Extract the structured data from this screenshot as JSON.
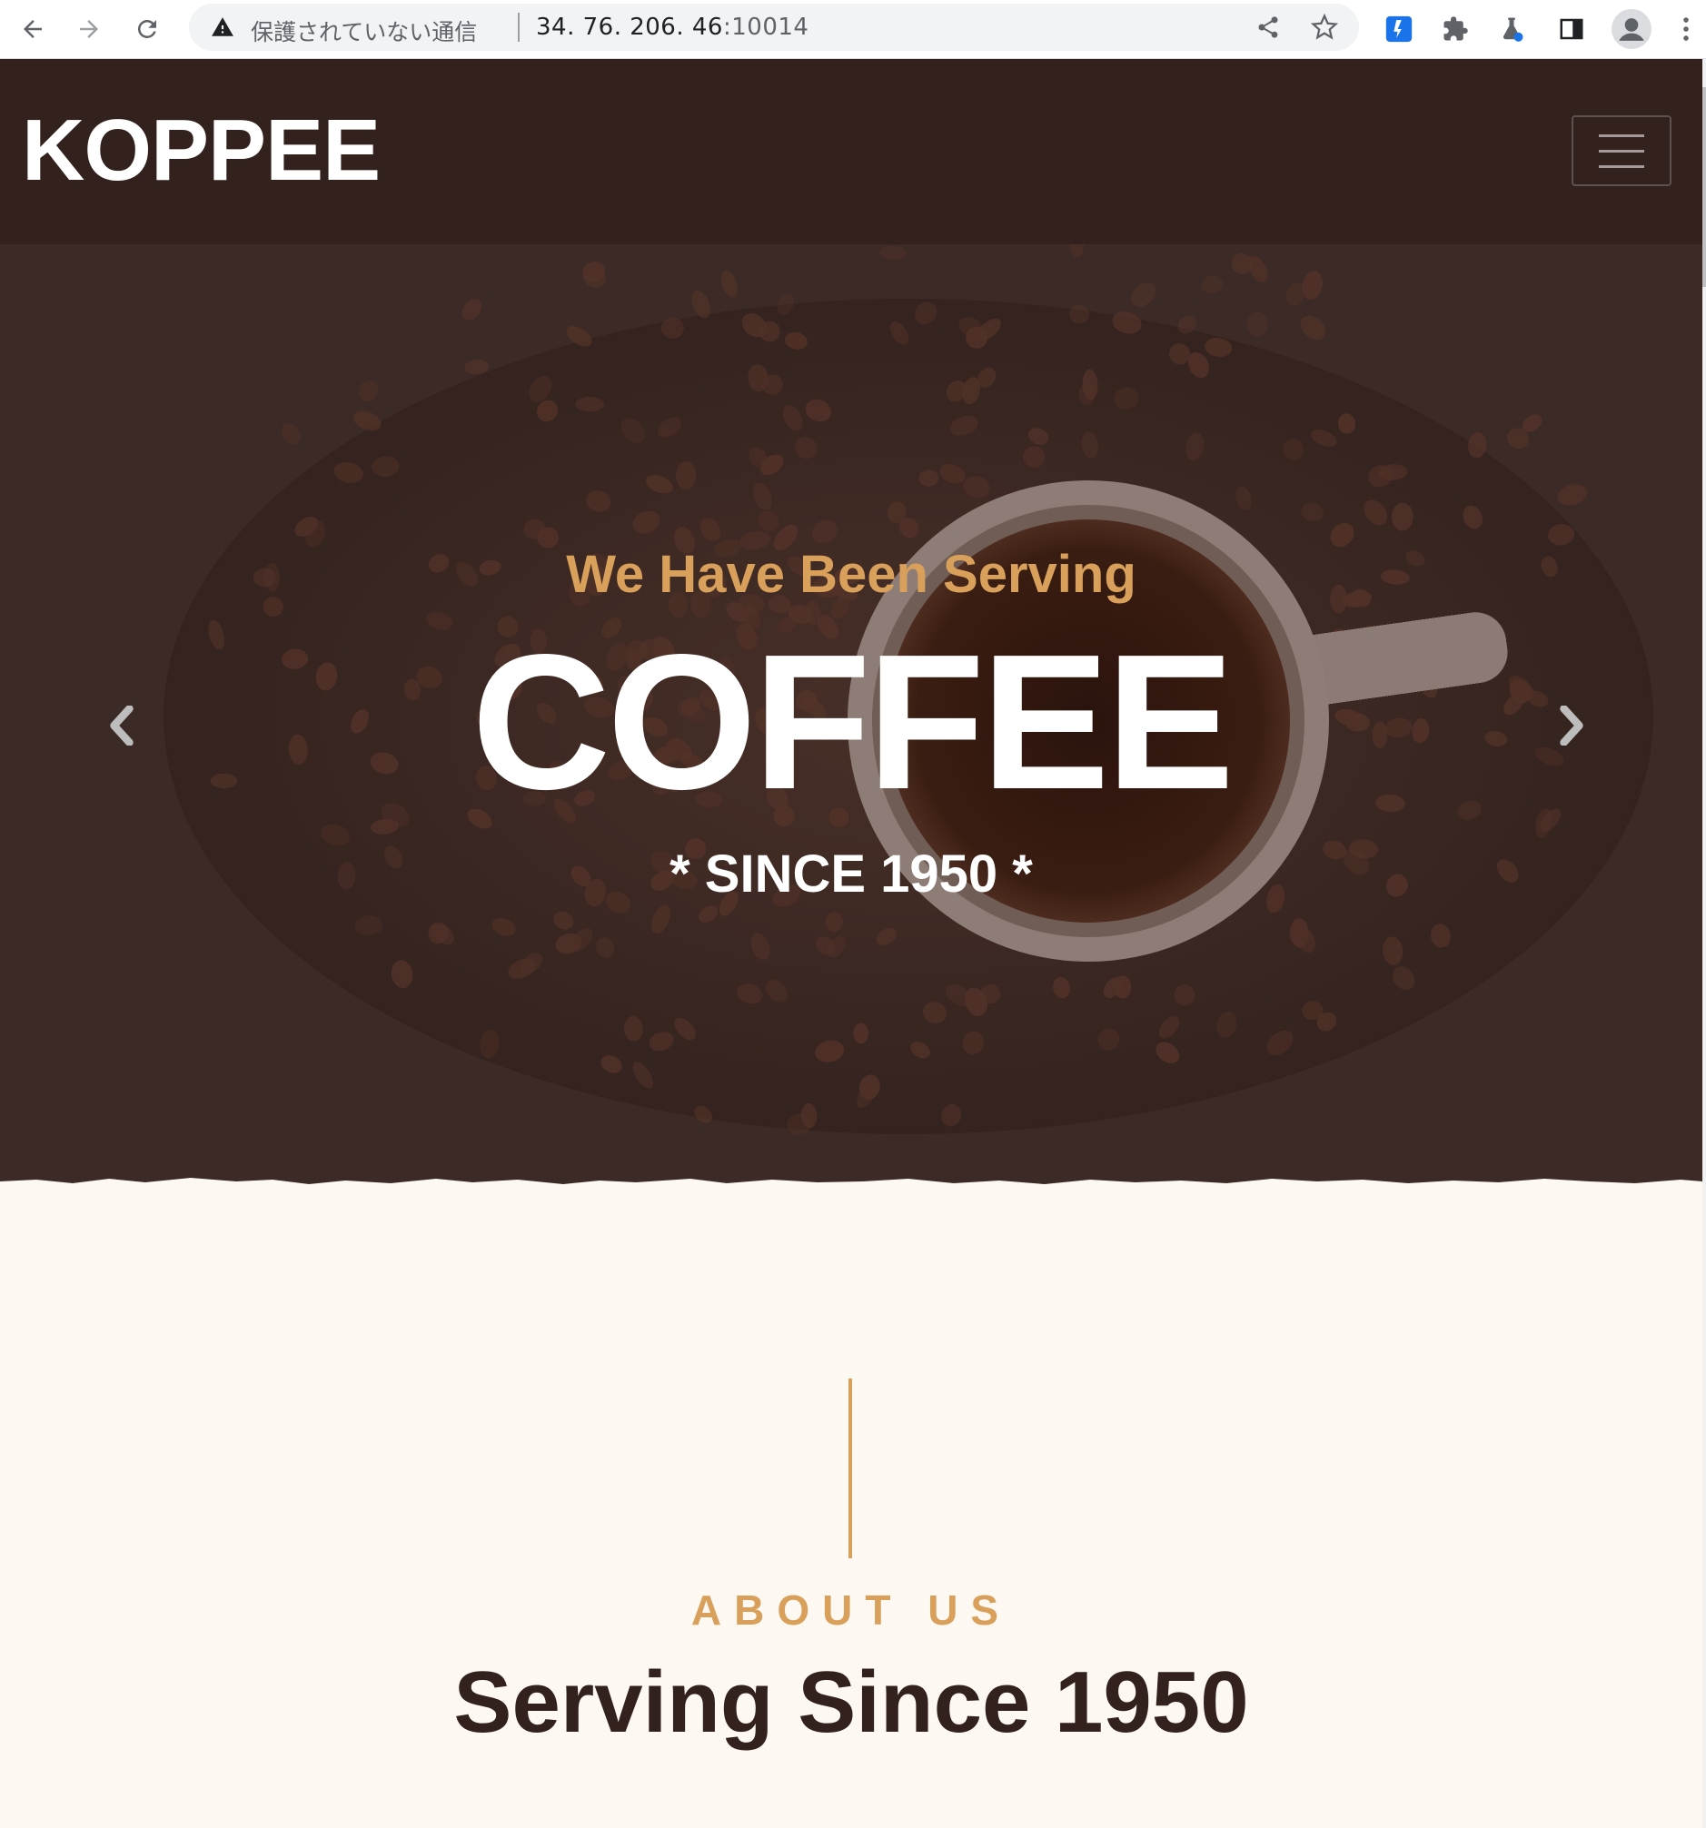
{
  "browser": {
    "insecure_label": "保護されていない通信",
    "url_host": "34. 76. 206. 46",
    "url_port": ":10014",
    "back_icon": "arrow-left-icon",
    "forward_icon": "arrow-right-icon",
    "reload_icon": "reload-icon",
    "warning_icon": "warning-triangle-icon",
    "share_icon": "share-icon",
    "bookmark_icon": "star-icon",
    "extension_icon": "puzzle-icon",
    "profile_icon": "avatar-icon",
    "menu_icon": "kebab-menu-icon"
  },
  "navbar": {
    "brand": "KOPPEE",
    "toggler_icon": "hamburger-icon"
  },
  "hero": {
    "tagline": "We Have Been Serving",
    "title": "COFFEE",
    "since": "* SINCE 1950 *",
    "prev_icon": "chevron-left-icon",
    "next_icon": "chevron-right-icon"
  },
  "about": {
    "label": "ABOUT US",
    "title": "Serving Since 1950"
  },
  "colors": {
    "dark_brown": "#33211d",
    "accent_gold": "#d9a05b",
    "cream": "#fdf8f2",
    "white": "#ffffff"
  }
}
